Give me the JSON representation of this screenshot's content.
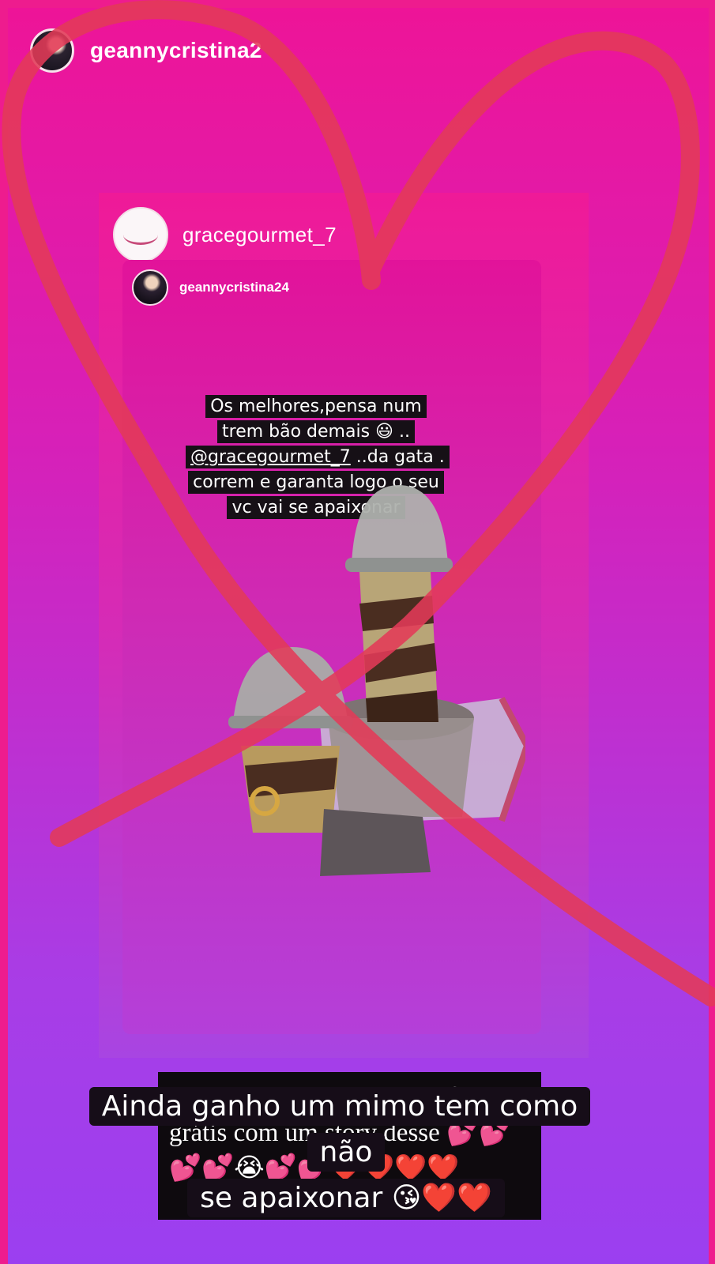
{
  "story": {
    "username": "geannycristina2",
    "caption_line1": "Ainda ganho um mimo tem como não",
    "caption_line2": "se apaixonar",
    "caption_emoji": "😘❤️❤️"
  },
  "shared_post": {
    "username": "gracegourmet_7",
    "inner_story": {
      "username": "geannycristina24",
      "caption_part1": "Os melhores,pensa num trem bão demais 😃 .. ",
      "mention": "@gracegourmet_7",
      "caption_part2": " ..da gata . correm e garanta logo o seu vc vai se apaixonar"
    },
    "comment": {
      "text": "Ameiiiiiiii ganhou uma trufa grátis com um story desse ",
      "emoji": "💕💕💕💕😭💕💕❤️❤️❤️❤️"
    }
  },
  "colors": {
    "background_top": "#ee1497",
    "background_bottom": "#9b3ff0",
    "heart_drawing": "#e23a58",
    "caption_box": "#161016"
  },
  "icons": [
    "profile-avatar",
    "grace-gourmet-logo",
    "heart-drawing"
  ]
}
